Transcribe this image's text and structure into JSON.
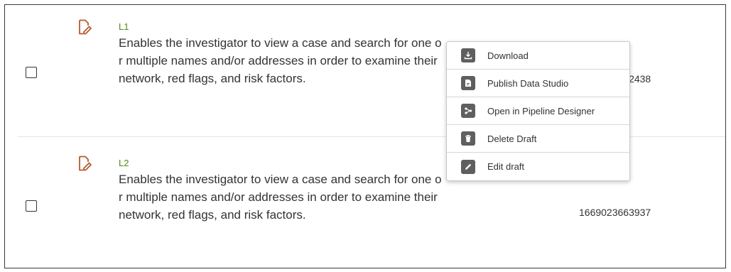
{
  "rows": [
    {
      "code": "L1",
      "description": "Enables the investigator to view a case and search for one or multiple names and/or addresses in order to examine their network, red flags, and risk factors.",
      "id": "1669023642438"
    },
    {
      "code": "L2",
      "description": "Enables the investigator to view a case and search for one or multiple names and/or addresses in order to examine their network, red flags, and risk factors.",
      "id": "1669023663937"
    }
  ],
  "context_menu": {
    "items": [
      {
        "label": "Download",
        "icon": "download-icon"
      },
      {
        "label": "Publish Data Studio",
        "icon": "publish-icon"
      },
      {
        "label": "Open in Pipeline Designer",
        "icon": "pipeline-icon"
      },
      {
        "label": "Delete Draft",
        "icon": "trash-icon"
      },
      {
        "label": "Edit draft",
        "icon": "pencil-icon"
      }
    ]
  },
  "colors": {
    "draft_icon": "#b5592d",
    "code_text": "#4f8a10",
    "menu_icon_bg": "#5f5f5f"
  }
}
